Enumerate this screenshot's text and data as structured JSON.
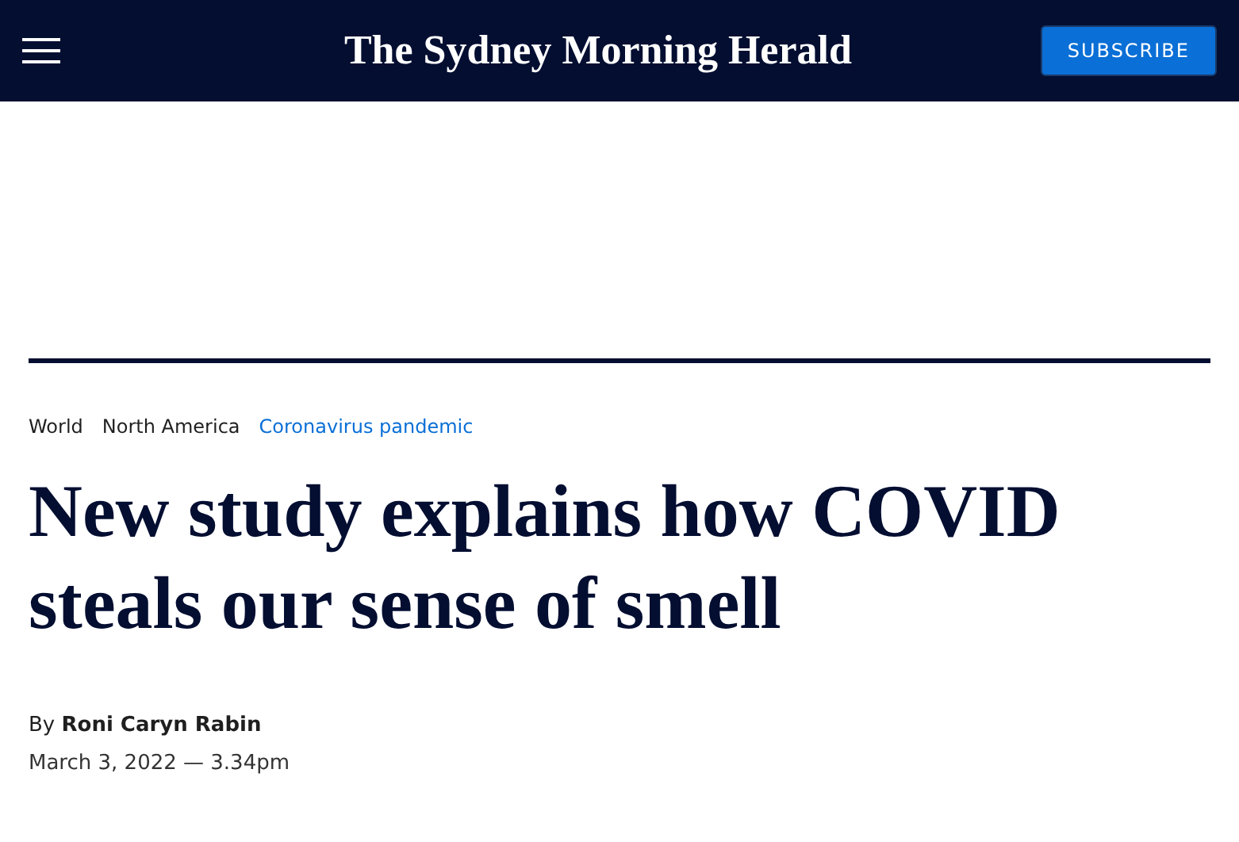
{
  "header": {
    "logo": "The Sydney Morning Herald",
    "subscribe_button": "SUBSCRIBE"
  },
  "breadcrumbs": [
    {
      "label": "World",
      "color": "#1f1f1f"
    },
    {
      "label": "North America",
      "color": "#1f1f1f"
    },
    {
      "label": "Coronavirus pandemic",
      "color": "#0a6fd6"
    }
  ],
  "article": {
    "headline": "New study explains how COVID steals our sense of smell",
    "byline": "By **Roni Caryn Rabin**",
    "date": "March 3, 2022 — 3.34pm"
  }
}
